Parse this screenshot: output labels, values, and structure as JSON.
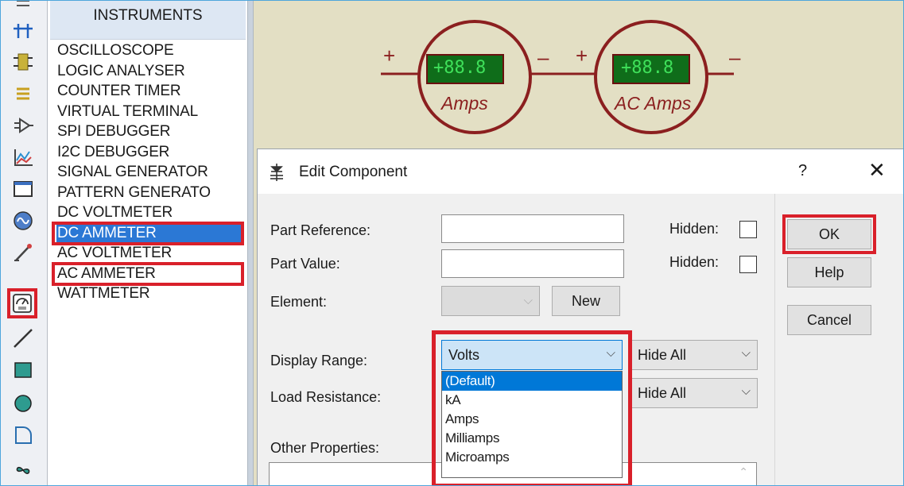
{
  "toolbar": {
    "tools": [
      {
        "icon": "junction-dot-icon",
        "glyph": "⁝"
      },
      {
        "icon": "wire-label-icon",
        "glyph": "+"
      },
      {
        "icon": "text-script-icon",
        "glyph": "╪"
      },
      {
        "icon": "bus-icon",
        "glyph": "☰"
      },
      {
        "icon": "subcircuit-icon",
        "glyph": "▷"
      },
      {
        "icon": "graph-icon",
        "glyph": "〽"
      },
      {
        "icon": "tape-recorder-icon",
        "glyph": "▭"
      },
      {
        "icon": "generator-icon",
        "glyph": "∽"
      },
      {
        "icon": "voltage-probe-icon",
        "glyph": "✎"
      },
      {
        "icon": "virtual-instruments-icon",
        "glyph": "◷"
      },
      {
        "icon": "line-icon",
        "glyph": "╱"
      },
      {
        "icon": "box-icon",
        "glyph": "■"
      },
      {
        "icon": "circle-icon",
        "glyph": "●"
      },
      {
        "icon": "arc-icon",
        "glyph": "◜"
      },
      {
        "icon": "path-icon",
        "glyph": "∞"
      }
    ]
  },
  "instruments": {
    "title": "INSTRUMENTS",
    "items": [
      "OSCILLOSCOPE",
      "LOGIC ANALYSER",
      "COUNTER TIMER",
      "VIRTUAL TERMINAL",
      "SPI DEBUGGER",
      "I2C DEBUGGER",
      "SIGNAL GENERATOR",
      "PATTERN GENERATO",
      "DC VOLTMETER",
      "DC AMMETER",
      "AC VOLTMETER",
      "AC AMMETER",
      "WATTMETER"
    ],
    "selected": "DC AMMETER"
  },
  "schematic": {
    "meters": [
      {
        "reading": "+88.8",
        "unit": "Amps",
        "plus": "+",
        "minus": "–"
      },
      {
        "reading": "+88.8",
        "unit": "AC Amps",
        "plus": "+",
        "minus": "–"
      }
    ],
    "colors": {
      "canvas": "#e3dfc4",
      "meter_ring": "#8b1f1f",
      "display_bg": "#0f6d1a",
      "display_text": "#3fe05a",
      "unit_text": "#8b1f1f"
    }
  },
  "dialog": {
    "title": "Edit Component",
    "help": "?",
    "close": "✕",
    "part_reference_label": "Part Reference:",
    "part_value_label": "Part Value:",
    "element_label": "Element:",
    "hidden_label_1": "Hidden:",
    "hidden_label_2": "Hidden:",
    "new_button": "New",
    "display_range_label": "Display Range:",
    "display_range_value": "Volts",
    "load_resistance_label": "Load Resistance:",
    "hide_all_1": "Hide All",
    "hide_all_2": "Hide All",
    "other_properties_label": "Other Properties:",
    "ok": "OK",
    "help_button": "Help",
    "cancel": "Cancel",
    "dropdown_options": [
      "(Default)",
      "kA",
      "Amps",
      "Milliamps",
      "Microamps"
    ],
    "dropdown_selected": "(Default)"
  },
  "highlight_color": "#d9202a"
}
